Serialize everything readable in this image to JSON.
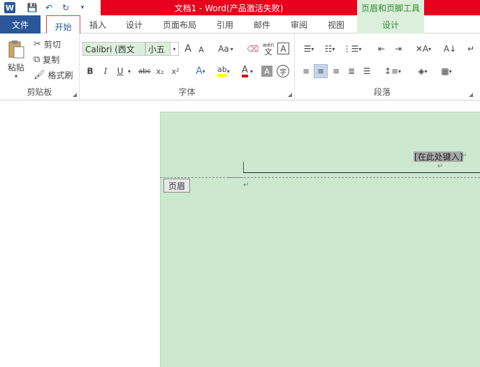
{
  "title_bar": {
    "doc_title": "文档1 -  Word(产品激活失败)",
    "context_header": "页眉和页脚工具",
    "word_icon": "W"
  },
  "qat": {
    "icons": [
      "save-icon",
      "undo-icon",
      "redo-icon",
      "customize-icon"
    ]
  },
  "tabs": [
    "文件",
    "开始",
    "插入",
    "设计",
    "页面布局",
    "引用",
    "邮件",
    "审阅",
    "视图",
    "设计"
  ],
  "ribbon": {
    "clipboard": {
      "paste": "粘贴",
      "cut": "剪切",
      "copy": "复制",
      "format_painter": "格式刷",
      "label": "剪贴板"
    },
    "font": {
      "font_name": "Calibri (西文",
      "font_size": "小五",
      "label": "字体",
      "wen_top": "wén",
      "wen_bottom": "文",
      "aa": "Aa",
      "bold": "B",
      "italic": "I",
      "underline": "U",
      "strike": "abc",
      "subscript": "x₂",
      "superscript": "x²",
      "grow": "A",
      "shrink": "A"
    },
    "paragraph": {
      "label": "段落"
    }
  },
  "document": {
    "placeholder": "[在此处键入]",
    "header_tag": "页眉"
  },
  "colors": {
    "accent": "#2b579a",
    "title_red": "#e8001c",
    "context_green": "#dcefdc",
    "page_green": "#cce8cf"
  }
}
